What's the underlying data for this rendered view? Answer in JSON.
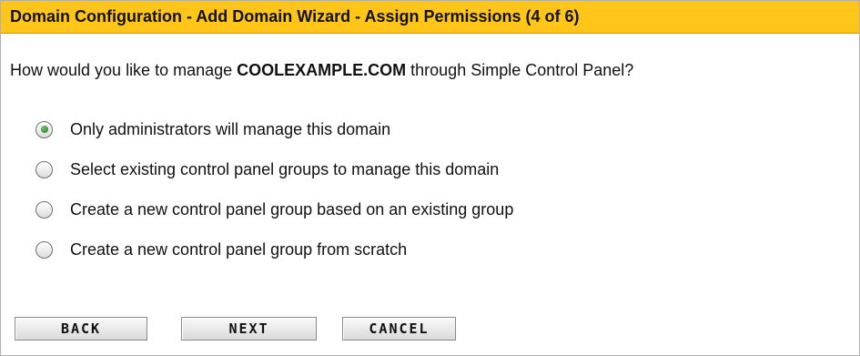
{
  "title": "Domain Configuration - Add Domain Wizard - Assign Permissions (4 of 6)",
  "question": {
    "prefix": "How would you like to manage ",
    "domain": "COOLEXAMPLE.COM",
    "suffix": " through Simple Control Panel?"
  },
  "options": [
    {
      "label": "Only administrators will manage this domain",
      "checked": true
    },
    {
      "label": "Select existing control panel groups to manage this domain",
      "checked": false
    },
    {
      "label": "Create a new control panel group based on an existing group",
      "checked": false
    },
    {
      "label": "Create a new control panel group from scratch",
      "checked": false
    }
  ],
  "buttons": {
    "back": "BACK",
    "next": "NEXT",
    "cancel": "CANCEL"
  },
  "colors": {
    "title_bar": "#ffc619",
    "radio_selected": "#1f7a1f"
  }
}
